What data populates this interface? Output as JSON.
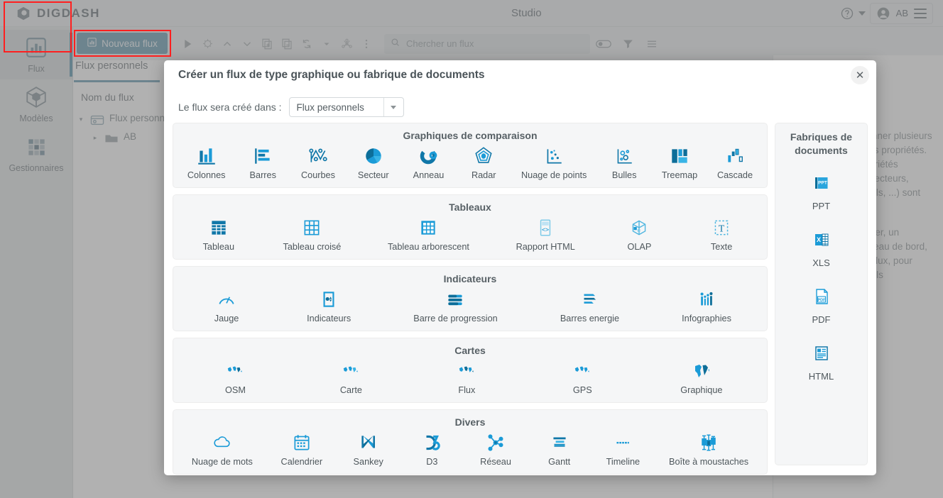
{
  "app": {
    "brand": "DIGDASH",
    "window_title": "Studio",
    "user_initials": "AB"
  },
  "topbar": {
    "help_icon": "help-circle-icon",
    "caret_icon": "chevron-down-icon",
    "avatar_icon": "avatar-icon",
    "menu_icon": "hamburger-menu-icon"
  },
  "rail": {
    "items": [
      {
        "label": "Flux",
        "icon": "chart-bar-icon",
        "active": true
      },
      {
        "label": "Modèles",
        "icon": "cube-icon",
        "active": false
      },
      {
        "label": "Gestionnaires",
        "icon": "grid-squares-icon",
        "active": false
      }
    ]
  },
  "toolbar": {
    "new_flux_label": "Nouveau flux",
    "new_flux_icon": "chart-bar-icon",
    "icons": [
      "play-icon",
      "stop-icon",
      "chevron-up-icon",
      "chevron-down-icon",
      "duplicate-add-icon",
      "duplicate-remove-icon",
      "refresh-icon",
      "caret-down-icon",
      "graph-nodes-icon",
      "more-vertical-icon"
    ],
    "search_placeholder": "Chercher un flux",
    "search_value": "",
    "search_icon": "search-icon",
    "toggle_icon": "toggle-switch-icon",
    "filter_icon": "filter-funnel-icon",
    "list_icon": "list-lines-icon"
  },
  "panel": {
    "tab_label": "Flux personnels",
    "tree_header": "Nom du flux",
    "tree_rows": [
      {
        "label": "Flux personnels AB",
        "icon": "folder-root-icon",
        "arrow": "▾"
      },
      {
        "label": "AB",
        "icon": "folder-icon",
        "arrow": "▸"
      }
    ]
  },
  "help_panel": {
    "paragraphs": [
      "Vous pouvez sélectionner plusieurs flux pour modifier leurs propriétés. Seules certaines propriétés (dossier, description, lecteurs, modificateurs, appareils, ...) sont modifiables.",
      "Sélectionnez un dossier, un portefeuille ou un tableau de bord, puis sélectionnez les flux, pour indiquer quels flux qu'ils contiennent."
    ]
  },
  "modal": {
    "title": "Créer un flux de type graphique ou fabrique de documents",
    "close_icon": "close-icon",
    "close_label": "✕",
    "destination_label": "Le flux sera créé dans :",
    "destination_value": "Flux personnels",
    "destination_caret": "chevron-down-icon",
    "groups": [
      {
        "title": "Graphiques de comparaison",
        "tiles": [
          {
            "label": "Colonnes",
            "icon": "column-chart-icon"
          },
          {
            "label": "Barres",
            "icon": "bar-chart-icon"
          },
          {
            "label": "Courbes",
            "icon": "line-chart-icon"
          },
          {
            "label": "Secteur",
            "icon": "pie-chart-icon"
          },
          {
            "label": "Anneau",
            "icon": "donut-chart-icon"
          },
          {
            "label": "Radar",
            "icon": "radar-chart-icon"
          },
          {
            "label": "Nuage de points",
            "icon": "scatter-plot-icon"
          },
          {
            "label": "Bulles",
            "icon": "bubble-chart-icon"
          },
          {
            "label": "Treemap",
            "icon": "treemap-icon"
          },
          {
            "label": "Cascade",
            "icon": "waterfall-chart-icon"
          }
        ]
      },
      {
        "title": "Tableaux",
        "tiles": [
          {
            "label": "Tableau",
            "icon": "table-icon"
          },
          {
            "label": "Tableau croisé",
            "icon": "pivot-table-icon"
          },
          {
            "label": "Tableau arborescent",
            "icon": "tree-table-icon"
          },
          {
            "label": "Rapport HTML",
            "icon": "html-report-icon"
          },
          {
            "label": "OLAP",
            "icon": "olap-cube-icon"
          },
          {
            "label": "Texte",
            "icon": "text-box-icon"
          }
        ]
      },
      {
        "title": "Indicateurs",
        "tiles": [
          {
            "label": "Jauge",
            "icon": "gauge-icon"
          },
          {
            "label": "Indicateurs",
            "icon": "kpi-indicator-icon"
          },
          {
            "label": "Barre de progression",
            "icon": "progress-bar-icon"
          },
          {
            "label": "Barres energie",
            "icon": "energy-bars-icon"
          },
          {
            "label": "Infographies",
            "icon": "infographic-people-icon"
          }
        ]
      },
      {
        "title": "Cartes",
        "tiles": [
          {
            "label": "OSM",
            "icon": "world-map-icon"
          },
          {
            "label": "Carte",
            "icon": "world-map-icon"
          },
          {
            "label": "Flux",
            "icon": "world-map-icon"
          },
          {
            "label": "GPS",
            "icon": "world-map-icon"
          },
          {
            "label": "Graphique",
            "icon": "world-map-filled-icon"
          }
        ]
      },
      {
        "title": "Divers",
        "tiles": [
          {
            "label": "Nuage de mots",
            "icon": "cloud-icon"
          },
          {
            "label": "Calendrier",
            "icon": "calendar-icon"
          },
          {
            "label": "Sankey",
            "icon": "sankey-icon"
          },
          {
            "label": "D3",
            "icon": "d3-logo-icon"
          },
          {
            "label": "Réseau",
            "icon": "network-graph-icon"
          },
          {
            "label": "Gantt",
            "icon": "gantt-chart-icon"
          },
          {
            "label": "Timeline",
            "icon": "timeline-icon"
          },
          {
            "label": "Boîte à moustaches",
            "icon": "boxplot-icon"
          }
        ]
      }
    ],
    "documents": {
      "title": "Fabriques de documents",
      "tiles": [
        {
          "label": "PPT",
          "icon": "powerpoint-file-icon"
        },
        {
          "label": "XLS",
          "icon": "excel-file-icon"
        },
        {
          "label": "PDF",
          "icon": "pdf-file-icon"
        },
        {
          "label": "HTML",
          "icon": "html-file-icon"
        }
      ]
    }
  },
  "colors": {
    "accent_blue": "#1b9bd7",
    "accent_dark_blue": "#1077a8",
    "button_blue": "#5d94ab",
    "highlight_red": "#ff1f1f",
    "chrome_gray": "#eceff1",
    "text_gray": "#576065"
  }
}
